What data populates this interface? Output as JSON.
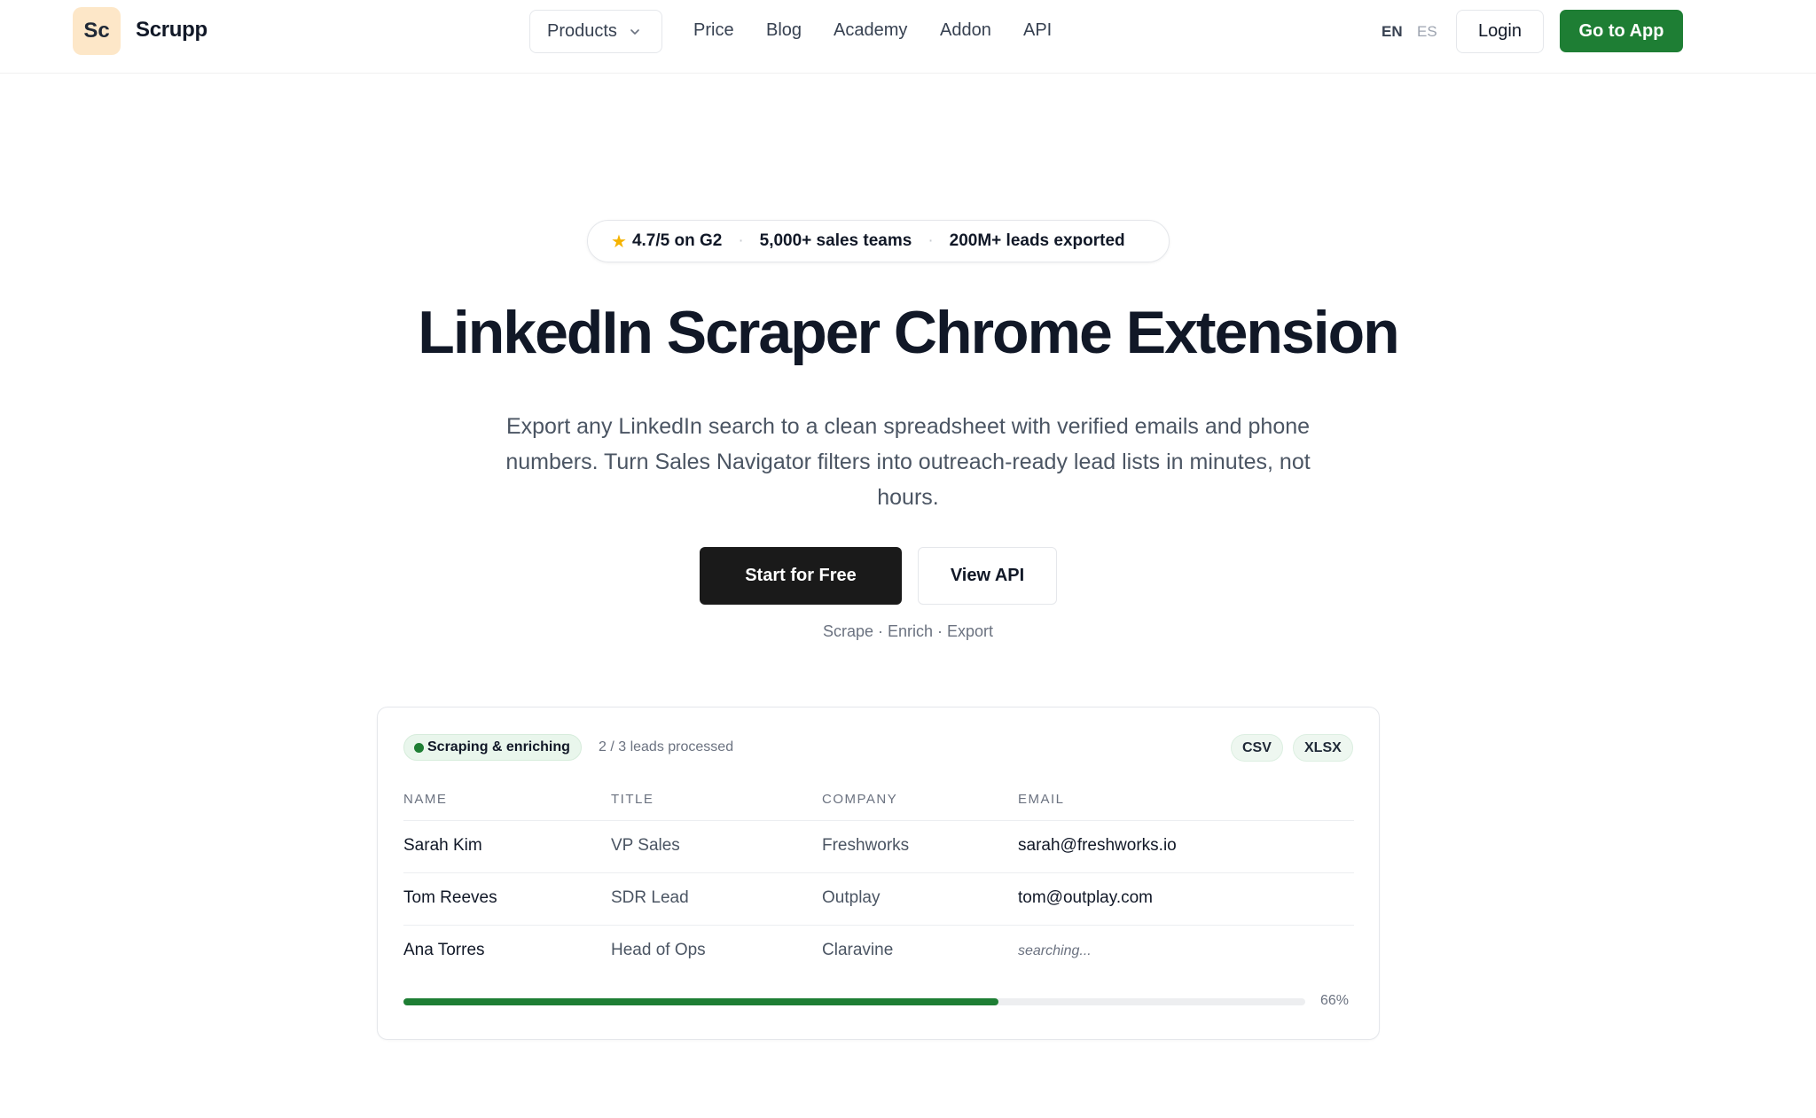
{
  "header": {
    "logo_text": "Sc",
    "brand": "Scrupp",
    "products_label": "Products",
    "nav": [
      "Price",
      "Blog",
      "Academy",
      "Addon",
      "API"
    ],
    "lang_active": "EN",
    "lang_inactive": "ES",
    "login_label": "Login",
    "cta_label": "Go to App",
    "cta_color": "#1e7e34"
  },
  "hero": {
    "rating": "4.7/5 on G2",
    "teams": "5,000+ sales teams",
    "leads": "200M+ leads exported",
    "title": "LinkedIn Scraper Chrome Extension",
    "subtitle": "Export any LinkedIn search to a clean spreadsheet with verified emails and phone numbers. Turn Sales Navigator filters into outreach-ready lead lists in minutes, not hours.",
    "primary_button": "Start for Free",
    "secondary_button": "View API",
    "tagline": "Scrape · Enrich · Export"
  },
  "demo": {
    "status": "Scraping & enriching",
    "progress_text": "2 / 3 leads processed",
    "formats": [
      "CSV",
      "XLSX"
    ],
    "columns": [
      "NAME",
      "TITLE",
      "COMPANY",
      "EMAIL"
    ],
    "rows": [
      {
        "name": "Sarah Kim",
        "title": "VP Sales",
        "company": "Freshworks",
        "email": "sarah@freshworks.io"
      },
      {
        "name": "Tom Reeves",
        "title": "SDR Lead",
        "company": "Outplay",
        "email": "tom@outplay.com"
      },
      {
        "name": "Ana Torres",
        "title": "Head of Ops",
        "company": "Claravine",
        "email": "searching..."
      }
    ],
    "progress_percent": 66,
    "progress_label": "66%",
    "accent_color": "#1e7e34"
  }
}
